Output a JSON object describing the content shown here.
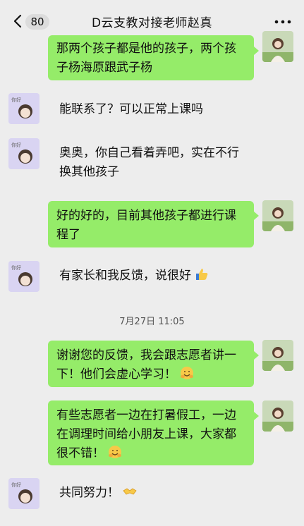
{
  "header": {
    "back_label": "<",
    "unread_count": "80",
    "title": "D云支教对接老师赵真",
    "more_label": "···"
  },
  "messages": [
    {
      "side": "right",
      "text": "那两个孩子都是他的孩子，两个孩子杨海原跟武子杨"
    },
    {
      "side": "left",
      "text": "能联系了？可以正常上课吗"
    },
    {
      "side": "left",
      "text": "奥奥，你自己看着弄吧，实在不行换其他孩子"
    },
    {
      "side": "right",
      "text": "好的好的，目前其他孩子都进行课程了"
    },
    {
      "side": "left",
      "text": "有家长和我反馈，说很好",
      "emoji": "thumbs-up-icon"
    },
    {
      "side": "right",
      "text": "谢谢您的反馈，我会跟志愿者讲一下！他们会虚心学习！",
      "emoji": "hug-face-icon"
    },
    {
      "side": "right",
      "text": "有些志愿者一边在打暑假工，一边在调理时间给小朋友上课，大家都很不错！",
      "emoji": "hug-face-icon"
    },
    {
      "side": "left",
      "text": "共同努力！",
      "emoji": "handshake-icon"
    }
  ],
  "timestamp": "7月27日 11:05",
  "colors": {
    "background": "#ededed",
    "own_bubble": "#95ec69"
  }
}
